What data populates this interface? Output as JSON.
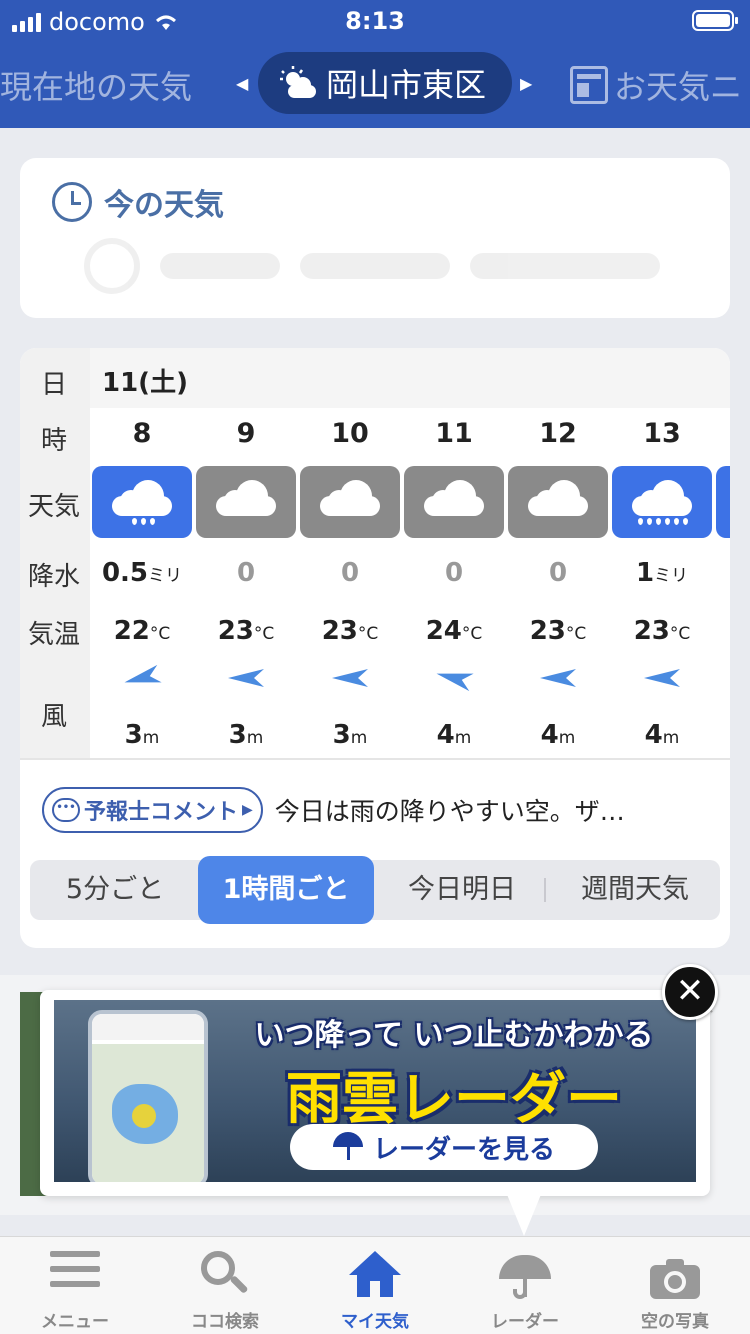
{
  "status_bar": {
    "carrier": "docomo",
    "time": "8:13"
  },
  "location_nav": {
    "prev_label": "現在地の天気",
    "current_label": "岡山市東区",
    "next_label": "お天気ニ"
  },
  "now_weather": {
    "title": "今の天気"
  },
  "forecast": {
    "row_labels": {
      "day": "日",
      "hour": "時",
      "weather": "天気",
      "precip": "降水",
      "temp": "気温",
      "wind": "風"
    },
    "date": "11(土)",
    "columns": [
      {
        "hour": "8",
        "weather": "rain",
        "precip": "0.5",
        "precip_unit": "ミリ",
        "temp": "22",
        "temp_unit": "°C",
        "wind_speed": "3",
        "wind_unit": "m",
        "wind_dir": "ENE"
      },
      {
        "hour": "9",
        "weather": "cloudy",
        "precip": "0",
        "precip_unit": "",
        "temp": "23",
        "temp_unit": "°C",
        "wind_speed": "3",
        "wind_unit": "m",
        "wind_dir": "E"
      },
      {
        "hour": "10",
        "weather": "cloudy",
        "precip": "0",
        "precip_unit": "",
        "temp": "23",
        "temp_unit": "°C",
        "wind_speed": "3",
        "wind_unit": "m",
        "wind_dir": "E"
      },
      {
        "hour": "11",
        "weather": "cloudy",
        "precip": "0",
        "precip_unit": "",
        "temp": "24",
        "temp_unit": "°C",
        "wind_speed": "4",
        "wind_unit": "m",
        "wind_dir": "ESE"
      },
      {
        "hour": "12",
        "weather": "cloudy",
        "precip": "0",
        "precip_unit": "",
        "temp": "23",
        "temp_unit": "°C",
        "wind_speed": "4",
        "wind_unit": "m",
        "wind_dir": "E"
      },
      {
        "hour": "13",
        "weather": "heavy-rain",
        "precip": "1",
        "precip_unit": "ミリ",
        "temp": "23",
        "temp_unit": "°C",
        "wind_speed": "4",
        "wind_unit": "m",
        "wind_dir": "E"
      }
    ],
    "comment_button": "予報士コメント",
    "comment_text": "今日は雨の降りやすい空。ザ…",
    "segments": [
      {
        "label": "5分ごと",
        "active": false
      },
      {
        "label": "1時間ごと",
        "active": true
      },
      {
        "label": "今日明日",
        "active": false
      },
      {
        "label": "週間天気",
        "active": false
      }
    ]
  },
  "ad": {
    "line1": "いつ降って いつ止むかわかる",
    "line2": "雨雲レーダー",
    "button": "レーダーを見る",
    "close": "✕"
  },
  "tabs": [
    {
      "label": "メニュー",
      "icon": "menu-icon",
      "active": false
    },
    {
      "label": "ココ検索",
      "icon": "search-icon",
      "active": false
    },
    {
      "label": "マイ天気",
      "icon": "home-icon",
      "active": true
    },
    {
      "label": "レーダー",
      "icon": "umbrella-icon",
      "active": false
    },
    {
      "label": "空の写真",
      "icon": "camera-icon",
      "active": false
    }
  ],
  "colors": {
    "header": "#3059b8",
    "accent": "#4e86e8",
    "rain_tile": "#3d72e6",
    "cloud_tile": "#8a8a8a"
  }
}
